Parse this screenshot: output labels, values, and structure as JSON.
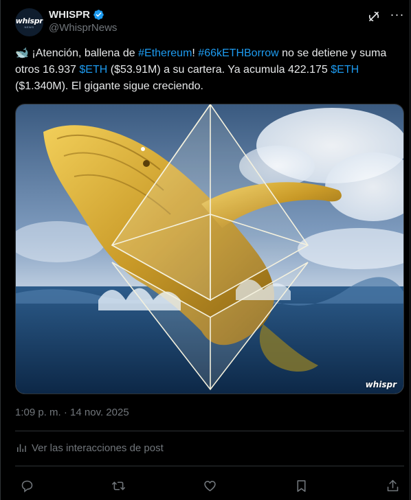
{
  "author": {
    "display_name": "WHISPR",
    "handle": "@WhisprNews",
    "avatar_text": "whispr",
    "avatar_subtext": "NEWS"
  },
  "tweet": {
    "emoji": "🐋",
    "segments": [
      {
        "text": " ¡Atención, ballena de ",
        "type": "text"
      },
      {
        "text": "#Ethereum",
        "type": "link"
      },
      {
        "text": "! ",
        "type": "text"
      },
      {
        "text": "#66kETHBorrow",
        "type": "link"
      },
      {
        "text": " no se detiene y suma otros 16.937 ",
        "type": "text"
      },
      {
        "text": "$ETH",
        "type": "link"
      },
      {
        "text": " ($53.91M) a su cartera. Ya acumula 422.175 ",
        "type": "text"
      },
      {
        "text": "$ETH",
        "type": "link"
      },
      {
        "text": " ($1.340M). El gigante sigue creciendo.",
        "type": "text"
      }
    ]
  },
  "media": {
    "watermark": "whispr"
  },
  "timestamp": "1:09 p. m. · 14 nov. 2025",
  "interactions_link": "Ver las interacciones de post",
  "colors": {
    "background": "#000000",
    "text": "#e7e9ea",
    "muted": "#71767b",
    "link": "#1d9bf0",
    "divider": "#2f3336",
    "verified": "#1d9bf0"
  },
  "icons": {
    "header": [
      "grok-icon",
      "more-icon"
    ],
    "actions": [
      "reply-icon",
      "repost-icon",
      "like-icon",
      "bookmark-icon",
      "share-icon"
    ]
  }
}
